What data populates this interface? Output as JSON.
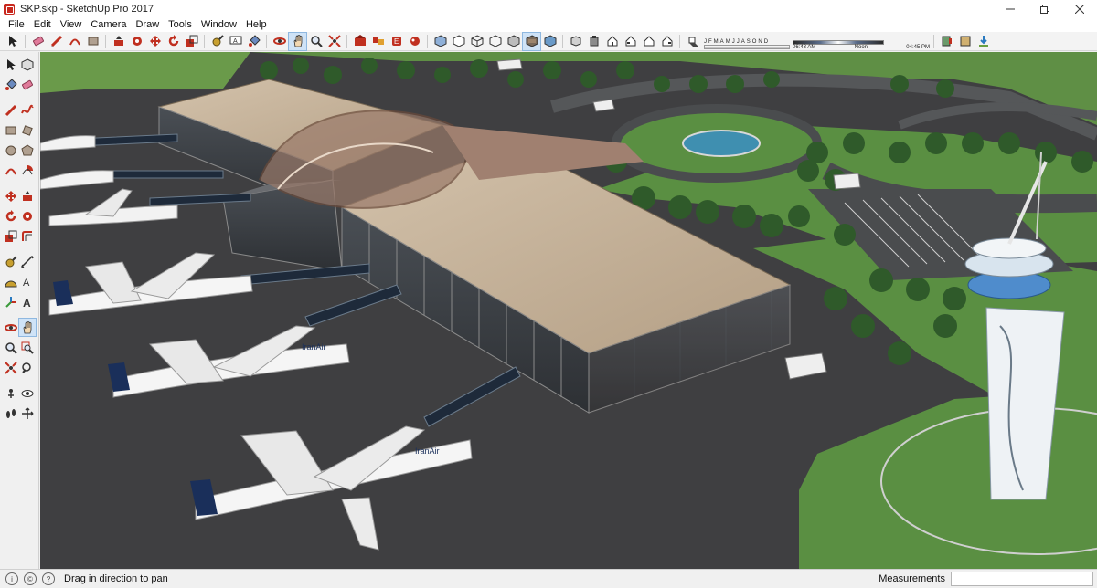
{
  "window": {
    "title": "SKP.skp - SketchUp Pro 2017"
  },
  "menu": [
    "File",
    "Edit",
    "View",
    "Camera",
    "Draw",
    "Tools",
    "Window",
    "Help"
  ],
  "shadow": {
    "months": [
      "J",
      "F",
      "M",
      "A",
      "M",
      "J",
      "J",
      "A",
      "S",
      "O",
      "N",
      "D"
    ],
    "time_start": "06:43 AM",
    "time_mid": "Noon",
    "time_end": "04:45 PM"
  },
  "status": {
    "hint": "Drag in direction to pan",
    "measurements_label": "Measurements",
    "measurements_value": ""
  },
  "aircraft_livery": "IranAir",
  "colors": {
    "accent_active": "#cfe3f7",
    "ground": "#3f3f41",
    "grass": "#5a8f42",
    "roof": "#c2b09a"
  }
}
